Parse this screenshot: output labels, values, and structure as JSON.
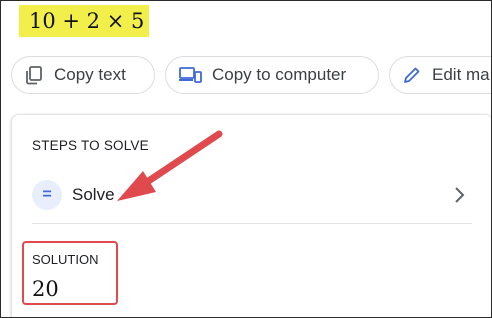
{
  "expression": "10 + 2 × 5",
  "actions": [
    {
      "label": "Copy text",
      "icon": "copy-icon"
    },
    {
      "label": "Copy to computer",
      "icon": "laptop-phone-icon"
    },
    {
      "label": "Edit ma",
      "icon": "pencil-icon"
    }
  ],
  "steps": {
    "heading": "STEPS TO SOLVE",
    "item_icon": "=",
    "item_label": "Solve"
  },
  "solution": {
    "heading": "SOLUTION",
    "value": "20"
  },
  "colors": {
    "highlight": "#f3ef4a",
    "annotation": "#e04a4f",
    "accent_icon": "#3f6ad8"
  }
}
